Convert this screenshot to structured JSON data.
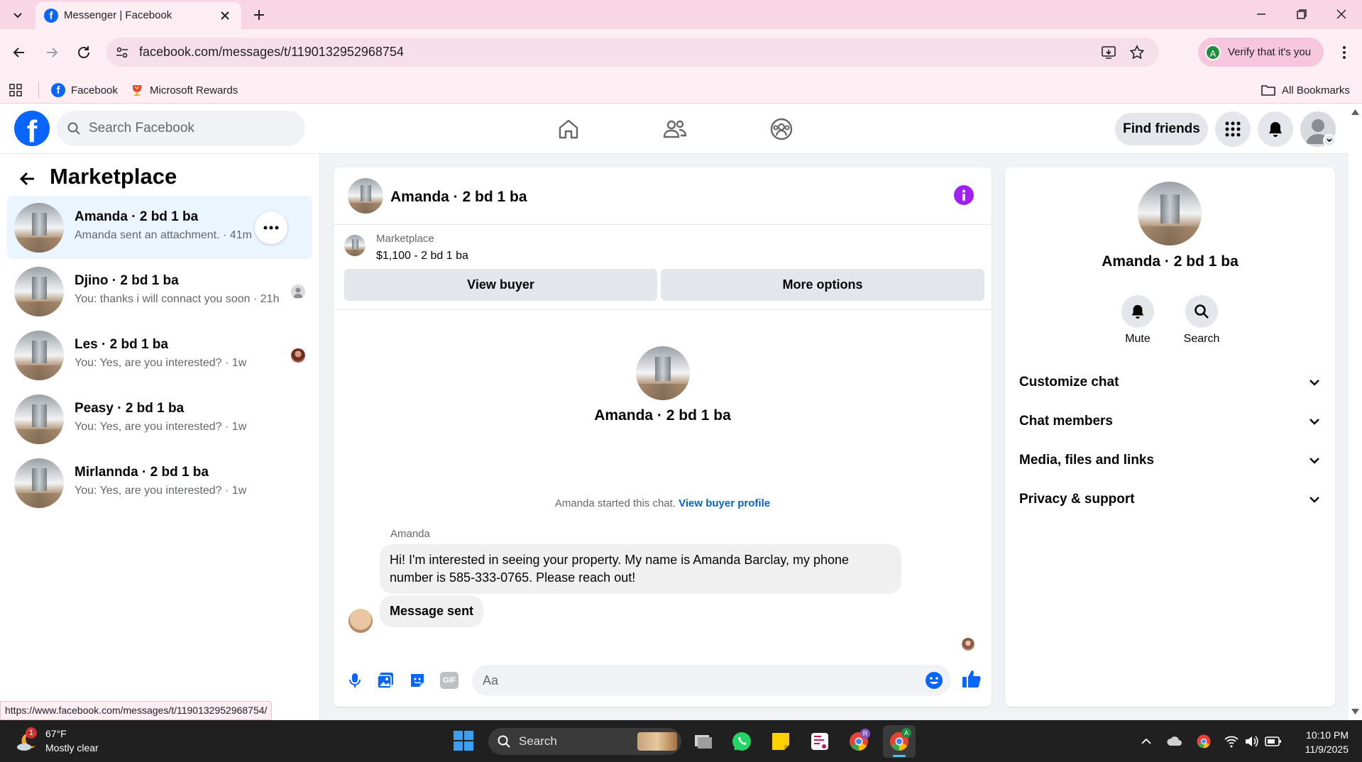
{
  "browser": {
    "tab_title": "Messenger | Facebook",
    "url": "facebook.com/messages/t/1190132952968754",
    "profile_chip": "Verify that it's you",
    "profile_initial": "A",
    "bookmarks": [
      {
        "label": "Facebook"
      },
      {
        "label": "Microsoft Rewards"
      }
    ],
    "all_bookmarks": "All Bookmarks",
    "status_url": "https://www.facebook.com/messages/t/1190132952968754/"
  },
  "fb": {
    "search_placeholder": "Search Facebook",
    "find_friends": "Find friends",
    "brand_color": "#0866ff"
  },
  "left": {
    "title": "Marketplace",
    "conversations": [
      {
        "title": "Amanda · 2 bd 1 ba",
        "sub": "Amanda sent an attachment. · 41m",
        "active": true
      },
      {
        "title": "Djino · 2 bd 1 ba",
        "sub": "You: thanks i will connact you soon · 21h"
      },
      {
        "title": "Les · 2 bd 1 ba",
        "sub": "You: Yes, are you interested? · 1w"
      },
      {
        "title": "Peasy · 2 bd 1 ba",
        "sub": "You: Yes, are you interested? · 1w"
      },
      {
        "title": "Mirlannda · 2 bd 1 ba",
        "sub": "You: Yes, are you interested? · 1w"
      }
    ]
  },
  "chat": {
    "header_title": "Amanda · 2 bd 1 ba",
    "listing_source": "Marketplace",
    "listing_price": "$1,100 - 2 bd 1 ba",
    "view_buyer": "View buyer",
    "more_options": "More options",
    "center_title": "Amanda · 2 bd 1 ba",
    "started_text": "Amanda started this chat.",
    "view_buyer_profile": "View buyer profile",
    "sender_name": "Amanda",
    "message1": "Hi! I'm interested in seeing your property. My name is Amanda Barclay, my phone number is 585-333-0765. Please reach out!",
    "message2": "Message sent",
    "composer_placeholder": "Aa",
    "gif_label": "GIF"
  },
  "right": {
    "title": "Amanda · 2 bd 1 ba",
    "mute": "Mute",
    "search": "Search",
    "sections": [
      "Customize chat",
      "Chat members",
      "Media, files and links",
      "Privacy & support"
    ]
  },
  "taskbar": {
    "temp": "67°F",
    "weather": "Mostly clear",
    "weather_badge": "1",
    "search": "Search",
    "time": "10:10 PM",
    "date": "11/9/2025"
  }
}
